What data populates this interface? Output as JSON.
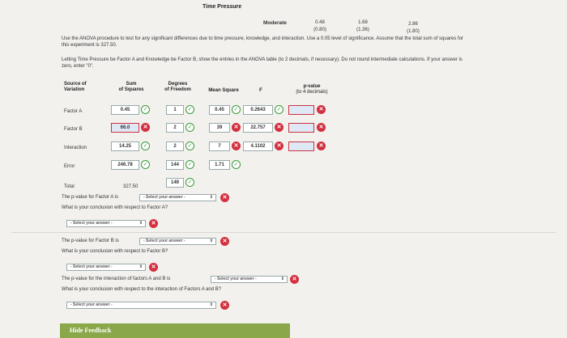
{
  "header": {
    "title": "Time Pressure",
    "level_label": "Moderate",
    "col1": {
      "v": "0.48",
      "sd": "(0.80)"
    },
    "col2": {
      "v": "1.68",
      "sd": "(1.36)"
    },
    "col3": {
      "v": "2.86",
      "sd": "(1.80)"
    }
  },
  "instructions": {
    "line1": "Use the ANOVA procedure to test for any significant differences due to time pressure, knowledge, and interaction. Use a 0.05 level of significance. Assume that the total sum of squares for",
    "line2": "this experiment is 327.50.",
    "line3": "Letting Time Pressure be Factor A and Knowledge be Factor B, show the entries in the ANOVA table (to 2 decimals, if necessary). Do not round intermediate calculations. If your answer is",
    "line4": "zero, enter \"0\"."
  },
  "table": {
    "headers": {
      "source": [
        "Source of",
        "Variation"
      ],
      "ss": [
        "Sum",
        "of Squares"
      ],
      "df": [
        "Degrees",
        "of Freedom"
      ],
      "ms": "Mean Square",
      "f": "F",
      "p": [
        "p-value",
        "(to 4 decimals)"
      ]
    },
    "rows": [
      {
        "label": "Factor A",
        "ss": "0.45",
        "df": "1",
        "ms": "0.45",
        "f": "0.2643"
      },
      {
        "label": "Factor B",
        "ss": "66.0",
        "df": "2",
        "ms": "39",
        "f": "22.757"
      },
      {
        "label": "Interaction",
        "ss": "14.25",
        "df": "2",
        "ms": "7",
        "f": "4.1102"
      },
      {
        "label": "Error",
        "ss": "246.78",
        "df": "144",
        "ms": "1.71"
      }
    ],
    "total": {
      "label": "Total",
      "ss": "327.50",
      "df": "149"
    }
  },
  "questions": {
    "qa_text": "The p-value for Factor A is",
    "qa_concl": "What is your conclusion with respect to Factor A?",
    "qb_text": "The p-value for Factor B is",
    "qb_concl": "What is your conclusion with respect to Factor B?",
    "qi_text": "The p-value for the interaction of factors A and B is",
    "qi_concl": "What is your conclusion with respect to the interaction of Factors A and B?",
    "select_placeholder": "- Select your answer -"
  },
  "feedback": {
    "label": "Hide Feedback"
  }
}
